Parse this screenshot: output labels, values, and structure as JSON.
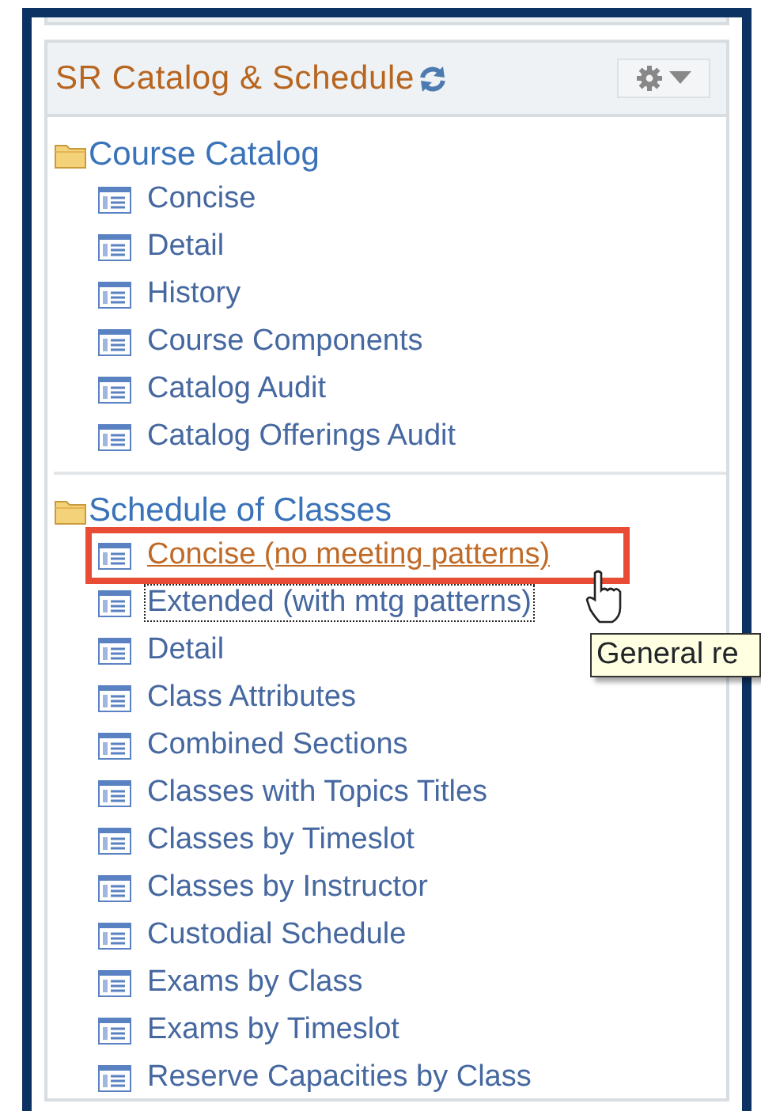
{
  "pagelet": {
    "title": "SR Catalog & Schedule"
  },
  "sections": [
    {
      "title": "Course Catalog",
      "items": [
        {
          "label": "Concise",
          "hovered": false,
          "focused": false
        },
        {
          "label": "Detail",
          "hovered": false,
          "focused": false
        },
        {
          "label": "History",
          "hovered": false,
          "focused": false
        },
        {
          "label": "Course Components",
          "hovered": false,
          "focused": false
        },
        {
          "label": "Catalog Audit",
          "hovered": false,
          "focused": false
        },
        {
          "label": "Catalog Offerings Audit",
          "hovered": false,
          "focused": false
        }
      ]
    },
    {
      "title": "Schedule of Classes",
      "items": [
        {
          "label": "Concise (no meeting patterns)",
          "hovered": true,
          "focused": false
        },
        {
          "label": "Extended (with mtg patterns)",
          "hovered": false,
          "focused": true
        },
        {
          "label": "Detail",
          "hovered": false,
          "focused": false
        },
        {
          "label": "Class Attributes",
          "hovered": false,
          "focused": false
        },
        {
          "label": "Combined Sections",
          "hovered": false,
          "focused": false
        },
        {
          "label": "Classes with Topics Titles",
          "hovered": false,
          "focused": false
        },
        {
          "label": "Classes by Timeslot",
          "hovered": false,
          "focused": false
        },
        {
          "label": "Classes by Instructor",
          "hovered": false,
          "focused": false
        },
        {
          "label": "Custodial Schedule",
          "hovered": false,
          "focused": false
        },
        {
          "label": "Exams by Class",
          "hovered": false,
          "focused": false
        },
        {
          "label": "Exams by Timeslot",
          "hovered": false,
          "focused": false
        },
        {
          "label": "Reserve Capacities by Class",
          "hovered": false,
          "focused": false
        }
      ]
    }
  ],
  "tooltip": {
    "text": "General re"
  }
}
